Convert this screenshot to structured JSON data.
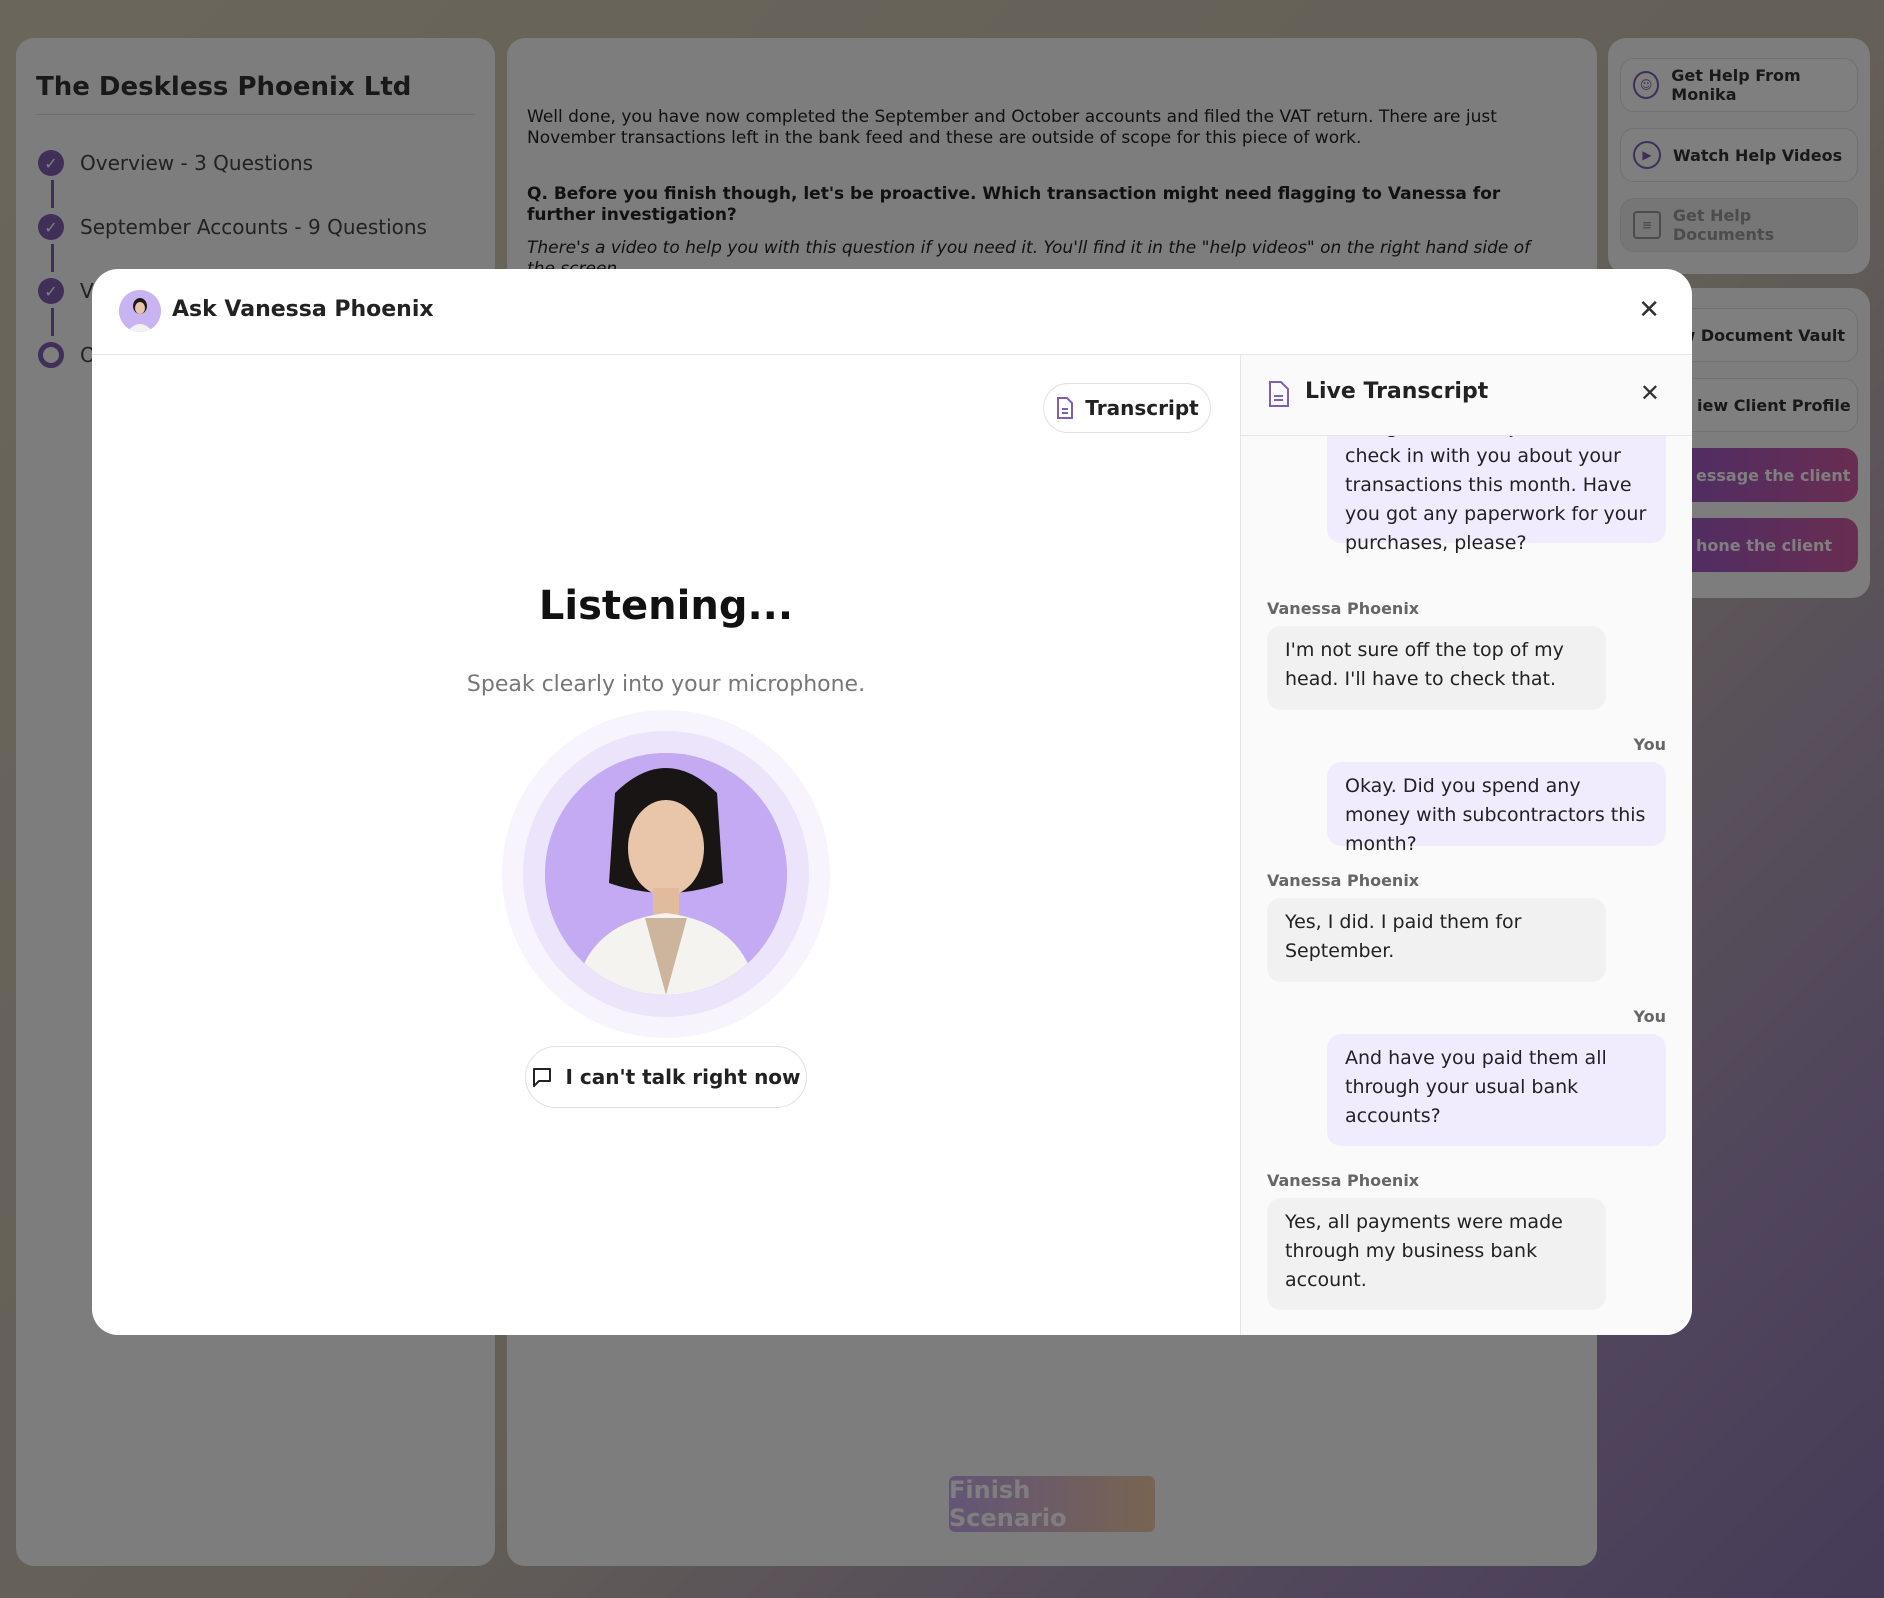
{
  "sidebar": {
    "company": "The Deskless Phoenix Ltd",
    "steps": [
      {
        "label": "Overview - 3 Questions"
      },
      {
        "label": "September Accounts - 9 Questions"
      },
      {
        "label": "V"
      },
      {
        "label": "O"
      }
    ]
  },
  "content": {
    "paragraph1": "Well done, you have now completed the September and October accounts and filed the VAT return. There are just November transactions left in the bank feed and these are outside of scope for this piece of work.",
    "question": "Q. Before you finish though, let's be proactive. Which transaction might need flagging to Vanessa for further investigation?",
    "hint": "There's a video to help you with this question if you need it. You'll find it in the \"help videos\" on the right hand side of the screen.",
    "finish_label": "Finish Scenario"
  },
  "help_panel": {
    "buttons": [
      {
        "label": "Get Help From Monika"
      },
      {
        "label": "Watch Help Videos"
      },
      {
        "label": "Get Help Documents"
      }
    ]
  },
  "action_panel": {
    "buttons": [
      {
        "label": "iew Document Vault"
      },
      {
        "label": "iew Client Profile"
      },
      {
        "label": "essage the client"
      },
      {
        "label": "hone the client"
      }
    ]
  },
  "modal": {
    "title": "Ask Vanessa Phoenix",
    "transcript_button": "Transcript",
    "status": "Listening...",
    "instruction": "Speak clearly into your microphone.",
    "cant_talk_label": "I can't talk right now"
  },
  "transcript": {
    "title": "Live Transcript",
    "messages": [
      {
        "speaker": "",
        "text": "doing well. Um, I just wanted to check in with you about your transactions this month. Have you got any paperwork for your purchases, please?"
      },
      {
        "speaker": "Vanessa Phoenix",
        "text": "I'm not sure off the top of my head. I'll have to check that."
      },
      {
        "speaker": "You",
        "text": "Okay. Did you spend any money with subcontractors this month?"
      },
      {
        "speaker": "Vanessa Phoenix",
        "text": "Yes, I did. I paid them for September."
      },
      {
        "speaker": "You",
        "text": "And have you paid them all through your usual bank accounts?"
      },
      {
        "speaker": "Vanessa Phoenix",
        "text": "Yes, all payments were made through my business bank account."
      }
    ]
  },
  "colors": {
    "accent": "#7f5fb2",
    "you_bubble": "#f1ecfd",
    "vp_bubble": "#f1f1f1"
  }
}
